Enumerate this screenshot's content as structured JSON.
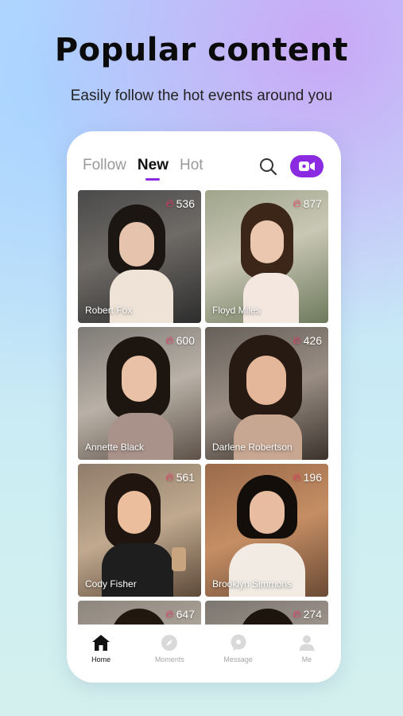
{
  "promo": {
    "headline": "Popular content",
    "subline": "Easily follow the hot events around you"
  },
  "tabs": [
    {
      "label": "Follow",
      "active": false
    },
    {
      "label": "New",
      "active": true
    },
    {
      "label": "Hot",
      "active": false
    }
  ],
  "icons": {
    "search": "search-icon",
    "live": "video-camera-icon",
    "like": "flame-icon"
  },
  "colors": {
    "accent": "#8a2be2",
    "flame": "#ff3d6e"
  },
  "cards": [
    {
      "name": "Robert Fox",
      "likes": "536"
    },
    {
      "name": "Floyd Miles",
      "likes": "877"
    },
    {
      "name": "Annette Black",
      "likes": "600"
    },
    {
      "name": "Darlene Robertson",
      "likes": "426"
    },
    {
      "name": "Cody Fisher",
      "likes": "561"
    },
    {
      "name": "Brooklyn Simmons",
      "likes": "196"
    },
    {
      "name": "",
      "likes": "647"
    },
    {
      "name": "",
      "likes": "274"
    }
  ],
  "nav": [
    {
      "label": "Home",
      "icon": "home-icon",
      "active": true
    },
    {
      "label": "Moments",
      "icon": "compass-icon",
      "active": false
    },
    {
      "label": "Message",
      "icon": "chat-icon",
      "active": false
    },
    {
      "label": "Me",
      "icon": "person-icon",
      "active": false
    }
  ]
}
